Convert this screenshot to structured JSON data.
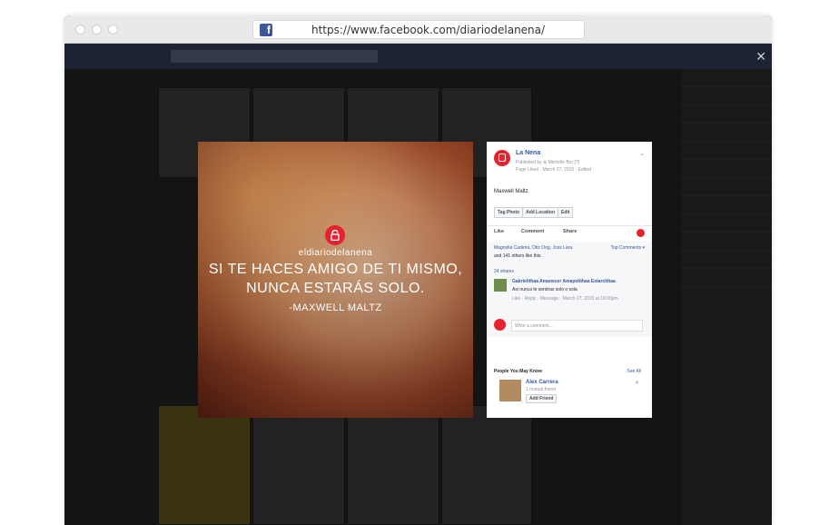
{
  "browser": {
    "url": "https://www.facebook.com/diariodelanena/"
  },
  "photo": {
    "logo_text": "eldiariodelanena",
    "quote_line1": "SI TE HACES AMIGO DE TI MISMO,",
    "quote_line2": "NUNCA ESTARÁS SOLO.",
    "quote_author": "-MAXWELL MALTZ"
  },
  "post": {
    "page_name": "La Nena",
    "published_by": "Published by ⊕ Michelle Bor [?]",
    "liked_info": "Page Liked · March 27, 2015 · Edited ·",
    "caption": "Maxwell Maltz",
    "buttons": [
      "Tag Photo",
      "Add Location",
      "Edit"
    ],
    "actions": {
      "like": "Like",
      "comment": "Comment",
      "share": "Share"
    },
    "likes_line1": "Magnolia Cadena, Otiz Oog, Joss Lara",
    "likes_line2": "and 141 others like this.",
    "top_comments": "Top Comments ▾",
    "shares": "24 shares",
    "comment": {
      "author": "Gabrielithaa Amanecer Amapolithaa Estarcithaa",
      "text": "Asi nunca te sentiras solo o sola",
      "meta": "Like · Reply · Message · March 27, 2015 at 10:00pm"
    },
    "write_placeholder": "Write a comment...",
    "pymk_title": "People You May Know",
    "see_all": "See All",
    "friend": {
      "name": "Alex Carrera",
      "mutual": "1 mutual friend",
      "add_label": "Add Friend"
    }
  },
  "colors": {
    "brand_red": "#e8212e",
    "facebook_blue": "#365899"
  }
}
